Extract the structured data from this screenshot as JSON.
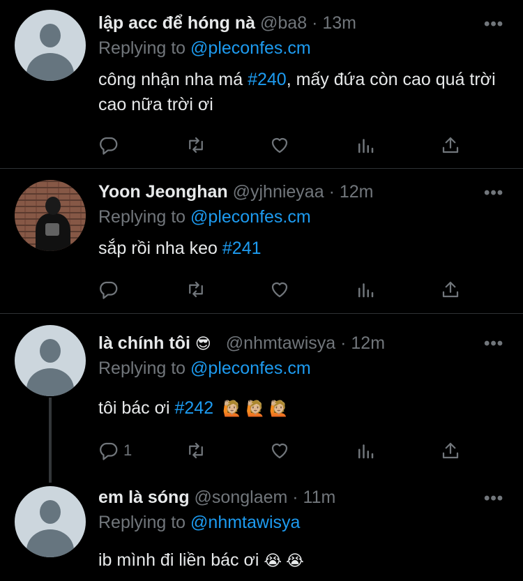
{
  "tweets": [
    {
      "name": "lập acc để hóng nà",
      "handle": "@ba8",
      "time": "· 13m",
      "replying_prefix": "Replying to",
      "replying_to": "@pleconfes.cm",
      "text_a": "công nhận nha má ",
      "hashtag": "#240",
      "text_b": ", mấy đứa còn cao quá trời cao nữa trời ơi",
      "more": "•••"
    },
    {
      "name": "Yoon Jeonghan",
      "handle": "@yjhnieyaa",
      "time": "· 12m",
      "replying_prefix": "Replying to",
      "replying_to": "@pleconfes.cm",
      "text_a": "sắp rồi nha keo ",
      "hashtag": "#241",
      "more": "•••"
    },
    {
      "name": "là chính tôi",
      "name_emoji": "😎",
      "handle": "@nhmtawisya",
      "time": "· 12m",
      "replying_prefix": "Replying to",
      "replying_to": "@pleconfes.cm",
      "text_a": "tôi bác ơi ",
      "hashtag": "#242",
      "text_emoji": "🙋🏼 🙋🏼 🙋🏼",
      "reply_count": "1",
      "more": "•••"
    },
    {
      "name": "em là sóng",
      "handle": "@songlaem",
      "time": "· 11m",
      "replying_prefix": "Replying to",
      "replying_to": "@nhmtawisya",
      "text_a": "ib mình đi liền bác ơi ",
      "text_emoji": "😭 😭",
      "more": "•••"
    }
  ],
  "icons": [
    "reply-icon",
    "retweet-icon",
    "like-icon",
    "views-icon",
    "share-icon",
    "more-icon"
  ],
  "colors": {
    "background": "#000000",
    "link": "#1d9bf0",
    "secondary": "#71767b",
    "divider": "#2f3336"
  }
}
